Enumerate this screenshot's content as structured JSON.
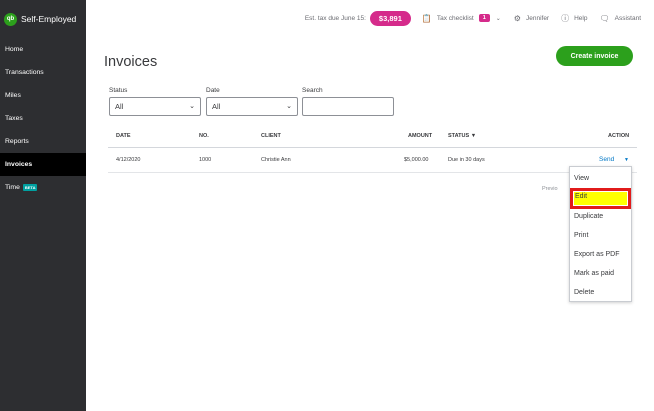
{
  "sidebar": {
    "brand_logo": "qb",
    "brand_name": "Self-Employed",
    "items": [
      {
        "label": "Home"
      },
      {
        "label": "Transactions"
      },
      {
        "label": "Miles"
      },
      {
        "label": "Taxes"
      },
      {
        "label": "Reports"
      },
      {
        "label": "Invoices",
        "active": true
      },
      {
        "label": "Time",
        "badge": "BETA"
      }
    ]
  },
  "header": {
    "tax_label": "Est. tax due June 15:",
    "tax_amount": "$3,891",
    "tax_checklist_label": "Tax checklist",
    "tax_checklist_count": "1",
    "user_name": "Jennifer",
    "help_label": "Help",
    "assistant_label": "Assistant",
    "icons": [
      "clipboard-icon",
      "chevron-down-icon",
      "gear-icon",
      "help-icon",
      "chat-icon"
    ]
  },
  "page": {
    "title": "Invoices",
    "create_button": "Create invoice"
  },
  "filters": {
    "status_label": "Status",
    "status_value": "All",
    "date_label": "Date",
    "date_value": "All",
    "search_label": "Search",
    "search_value": ""
  },
  "table": {
    "columns": [
      "DATE",
      "NO.",
      "CLIENT",
      "AMOUNT",
      "STATUS ▼",
      "ACTION"
    ],
    "rows": [
      {
        "date": "4/12/2020",
        "no": "1000",
        "client": "Christie Ann",
        "amount": "$5,000.00",
        "status": "Due in 30 days",
        "action": "Send"
      }
    ]
  },
  "pager": {
    "previous_label": "Previo"
  },
  "action_menu": {
    "items": [
      "View",
      "Edit",
      "Duplicate",
      "Print",
      "Export as PDF",
      "Mark as paid",
      "Delete"
    ],
    "highlighted": "Edit"
  },
  "colors": {
    "sidebar_bg": "#2d2e31",
    "accent_green": "#2ca01c",
    "tax_pink": "#d52b8b",
    "link_blue": "#0077c5",
    "highlight_red": "#e11b1b",
    "highlight_yellow": "#ffff00"
  }
}
